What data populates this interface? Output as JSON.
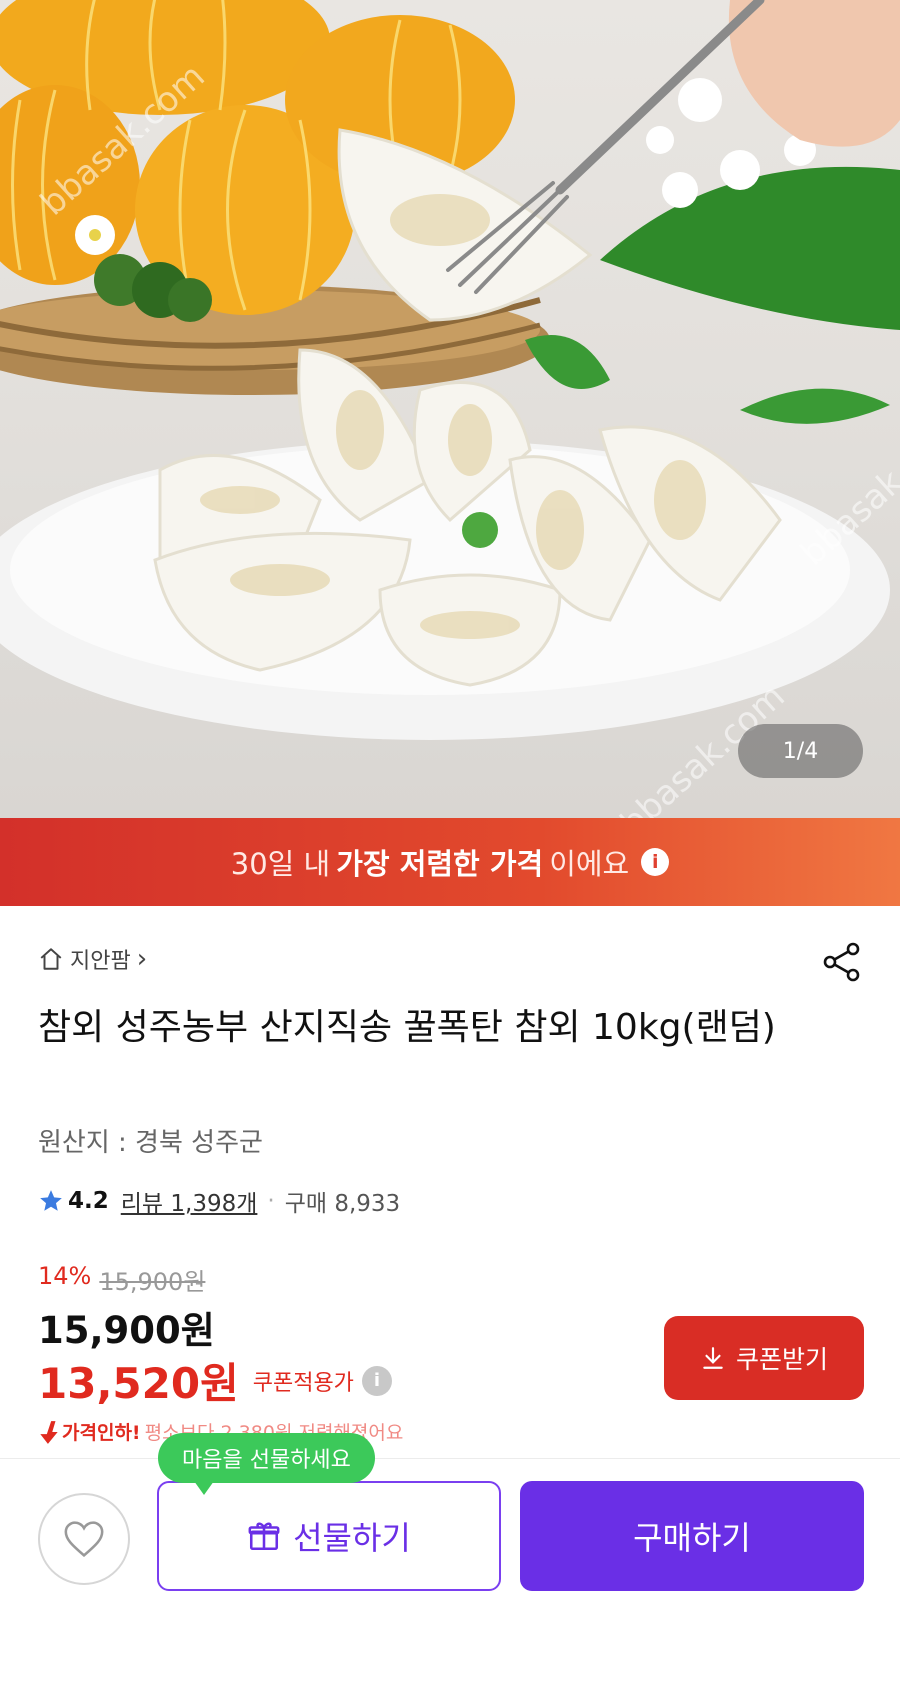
{
  "hero": {
    "pager": "1/4",
    "watermark": "bbasak.com"
  },
  "promo": {
    "pre": "30일 내",
    "bold": "가장 저렴한 가격",
    "post": "이에요",
    "info_glyph": "i"
  },
  "store": {
    "name": "지안팜",
    "chevron": "›"
  },
  "product": {
    "title": "참외 성주농부 산지직송 꿀폭탄 참외 10kg(랜덤)",
    "origin": "원산지 : 경북 성주군"
  },
  "rating": {
    "score": "4.2",
    "reviews": "리뷰 1,398개",
    "separator": "·",
    "purchases": "구매 8,933"
  },
  "price": {
    "discount_pct": "14%",
    "original": "15,900원",
    "regular": "15,900원",
    "coupon_price": "13,520원",
    "coupon_label": "쿠폰적용가",
    "info_glyph": "i",
    "coupon_button": "쿠폰받기",
    "drop_label": "가격인하!",
    "drop_detail": "평소보다 2,380원 저렴해졌어요"
  },
  "bottom": {
    "tooltip": "마음을 선물하세요",
    "gift_button": "선물하기",
    "buy_button": "구매하기"
  },
  "colors": {
    "accent_red": "#d92d25",
    "purple": "#6a2fe6",
    "green_tooltip": "#3cc95a",
    "star": "#3b7be0"
  }
}
